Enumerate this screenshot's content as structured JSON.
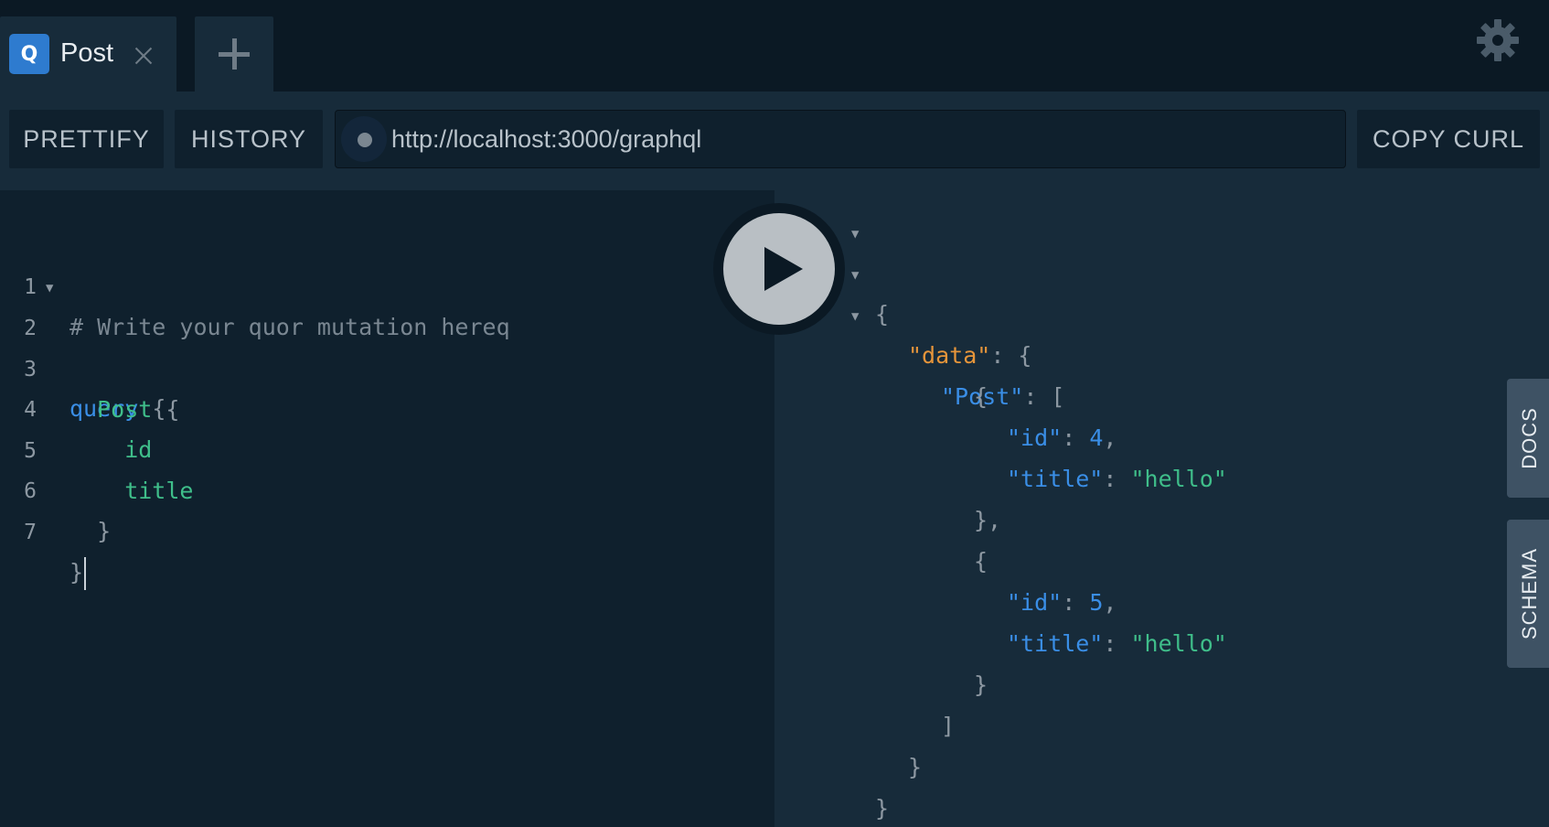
{
  "tabs": [
    {
      "badge": "Q",
      "label": "Post"
    }
  ],
  "toolbar": {
    "prettify_label": "PRETTIFY",
    "history_label": "HISTORY",
    "endpoint_url": "http://localhost:3000/graphql",
    "copy_curl_label": "COPY CURL"
  },
  "editor": {
    "lines": [
      {
        "num": "1",
        "text": "# Write your quor mutation hereq"
      },
      {
        "num": "2",
        "text_kw": "query",
        "text_punc": " {"
      },
      {
        "num": "3",
        "text_field": "  Post",
        "text_punc": " {"
      },
      {
        "num": "4",
        "text_field": "    id"
      },
      {
        "num": "5",
        "text_field": "    title"
      },
      {
        "num": "6",
        "text_punc": "  }"
      },
      {
        "num": "7",
        "text_punc": "}"
      }
    ]
  },
  "result": {
    "open_brace": "{",
    "data_key": "\"data\"",
    "post_key": "\"Post\"",
    "items": [
      {
        "id": "4",
        "title": "\"hello\""
      },
      {
        "id": "5",
        "title": "\"hello\""
      }
    ],
    "id_key": "\"id\"",
    "title_key": "\"title\""
  },
  "side_tabs": {
    "docs_label": "DOCS",
    "schema_label": "SCHEMA"
  },
  "colors": {
    "tab_badge": "#2e7bcf",
    "keyword": "#3a8ee6",
    "field": "#3fbe8a",
    "data_key": "#e6953a"
  },
  "icons": {
    "settings": "gear-icon",
    "close": "close-icon",
    "add": "plus-icon",
    "run": "play-icon"
  }
}
